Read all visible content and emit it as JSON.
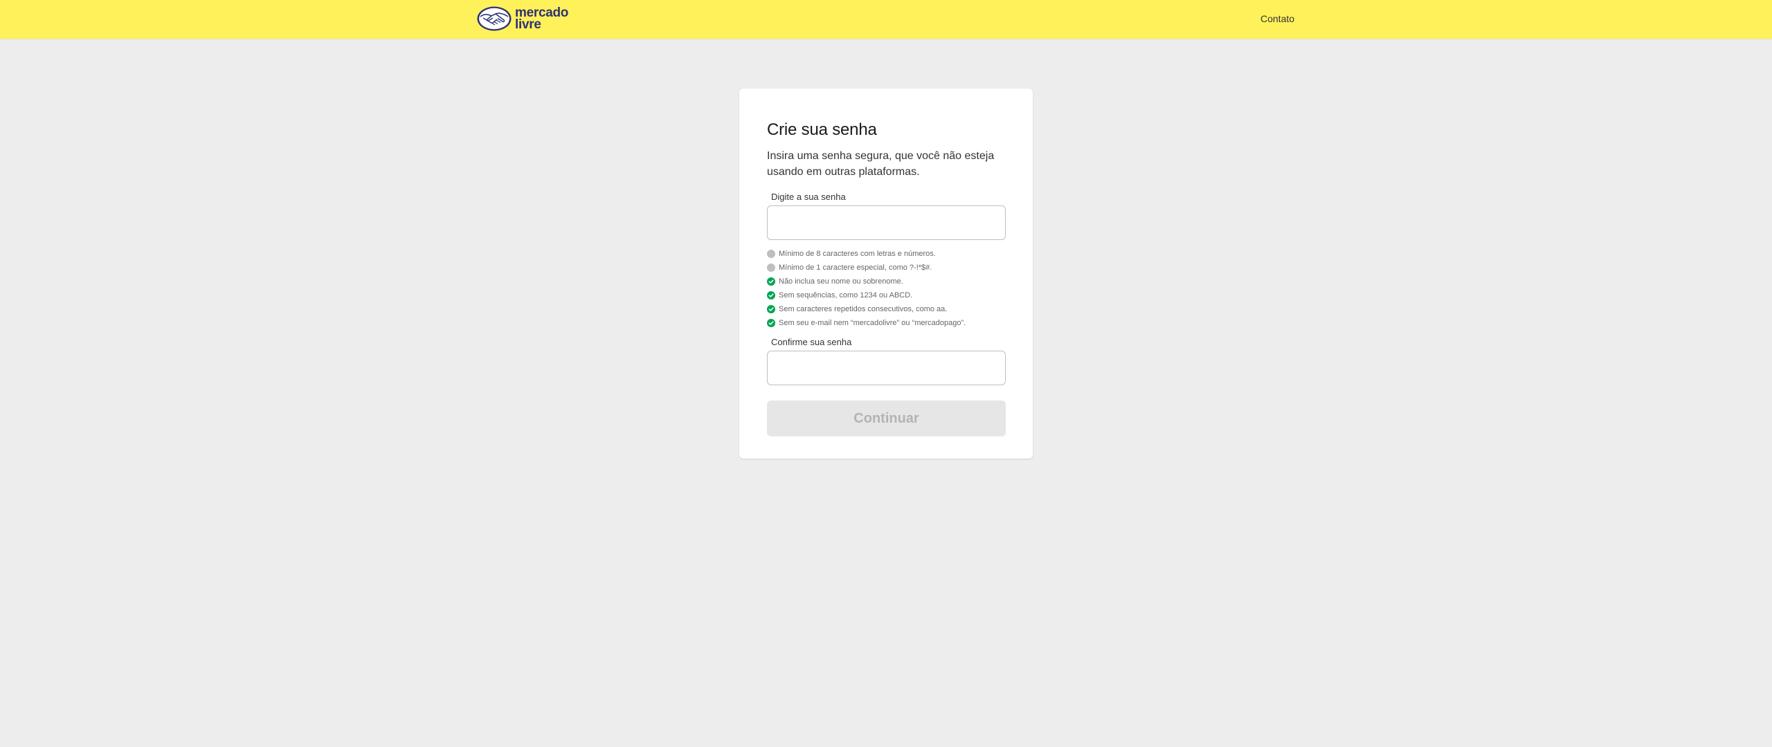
{
  "header": {
    "brand_line1": "mercado",
    "brand_line2": "livre",
    "contact_label": "Contato",
    "background_color": "#fff159",
    "brand_color": "#2d3277"
  },
  "form": {
    "title": "Crie sua senha",
    "subtitle": "Insira uma senha segura, que você não esteja usando em outras plataformas.",
    "password_label": "Digite a sua senha",
    "password_value": "",
    "rules": [
      {
        "text": "Mínimo de 8 caracteres com letras e números.",
        "status": "pending",
        "icon": "gray-circle-icon"
      },
      {
        "text": "Mínimo de 1 caractere especial, como ?-!*$#.",
        "status": "pending",
        "icon": "gray-circle-icon"
      },
      {
        "text": "Não inclua seu nome ou sobrenome.",
        "status": "valid",
        "icon": "green-check-icon"
      },
      {
        "text": "Sem sequências, como 1234 ou ABCD.",
        "status": "valid",
        "icon": "green-check-icon"
      },
      {
        "text": "Sem caracteres repetidos consecutivos, como aa.",
        "status": "valid",
        "icon": "green-check-icon"
      },
      {
        "text": "Sem seu e-mail nem “mercadolivre” ou “mercadopago”.",
        "status": "valid",
        "icon": "green-check-icon"
      }
    ],
    "confirm_label": "Confirme sua senha",
    "confirm_value": "",
    "continue_label": "Continuar",
    "continue_disabled": true,
    "valid_color": "#00a650",
    "pending_color": "#bfbfbf"
  }
}
